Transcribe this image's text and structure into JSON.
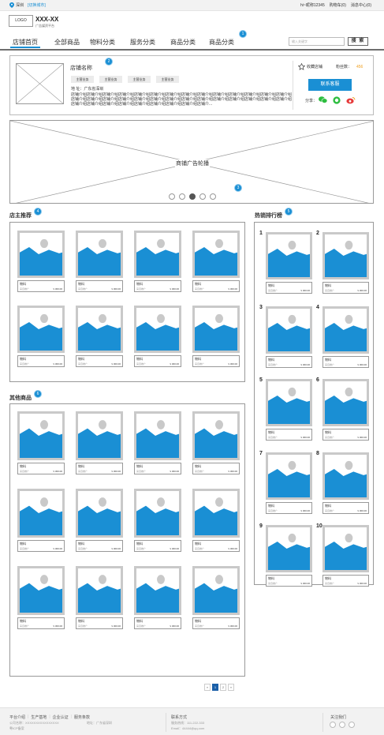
{
  "topbar": {
    "city": "深圳",
    "switch_city": "[切换城市]",
    "links": [
      "hi~昵称12345",
      "购物车(0)",
      "消息中心(0)"
    ]
  },
  "brand": {
    "logo": "LOGO",
    "name": "XXX-XX",
    "subtitle": "广告媒资平台"
  },
  "nav": {
    "items": [
      "店铺首页",
      "全部商品",
      "物料分类",
      "服务分类",
      "商品分类",
      "商品分类"
    ],
    "active_index": 0,
    "search_placeholder": "输入关键字",
    "search_button": "搜 索"
  },
  "badges": {
    "nav": "1",
    "shop": "2",
    "banner": "3",
    "recommend": "4",
    "ranking": "5",
    "others": "6"
  },
  "shop": {
    "name": "店铺名称",
    "tags": [
      "主营业务",
      "主营业务",
      "主营业务",
      "主营业务"
    ],
    "address": "地  址：广东省深圳",
    "intro": "店铺介绍店铺介绍店铺介绍店铺介绍店铺介绍店铺介绍店铺介绍店铺介绍店铺介绍店铺介绍店铺介绍店铺介绍店铺介绍店铺介绍店铺介绍店铺介绍店铺介绍店铺介绍店铺介绍店铺介绍店铺介绍店铺介绍店铺介绍店铺介绍店铺介绍店铺介绍店铺介绍店铺介绍店铺介绍店铺介绍店铺介绍店铺介绍店铺介绍店铺介绍店铺介绍店铺介绍店铺介...",
    "favorite": "收藏店铺",
    "fans_label": "粉丝数：",
    "fans_count": "456",
    "contact_button": "联系客服",
    "share_label": "分享："
  },
  "banner": {
    "caption": "商铺广告轮播",
    "dots": 5,
    "active_dot": 2
  },
  "sections": {
    "recommend_title": "店主推荐",
    "ranking_title": "热销排行榜",
    "others_title": "其他商品"
  },
  "product": {
    "name": "物料",
    "ad": "来自推广",
    "price": "¥ 300.00"
  },
  "ranking": {
    "numbers": [
      "1",
      "2",
      "3",
      "4",
      "5",
      "6",
      "7",
      "8",
      "9",
      "10"
    ]
  },
  "pager": {
    "pages": [
      "«",
      "1",
      "2",
      "»"
    ],
    "active": 1
  },
  "footer": {
    "links": [
      "平台介绍",
      "生产基地",
      "企业认证",
      "服务条款"
    ],
    "company_name": "公司名称：XXXXXXXXXXXXXXXX",
    "address": "地址：广东省深圳",
    "icp": "粤ICP备案",
    "contact_title": "联系方式",
    "phone": "服务热线：111-222-333",
    "email": "Email：44444@qq.com",
    "follow_title": "关注我们"
  },
  "colors": {
    "accent": "#1a8fd4",
    "fans": "#f0a020",
    "wechat": "#2dbd3f",
    "weibo": "#e63a3a"
  }
}
